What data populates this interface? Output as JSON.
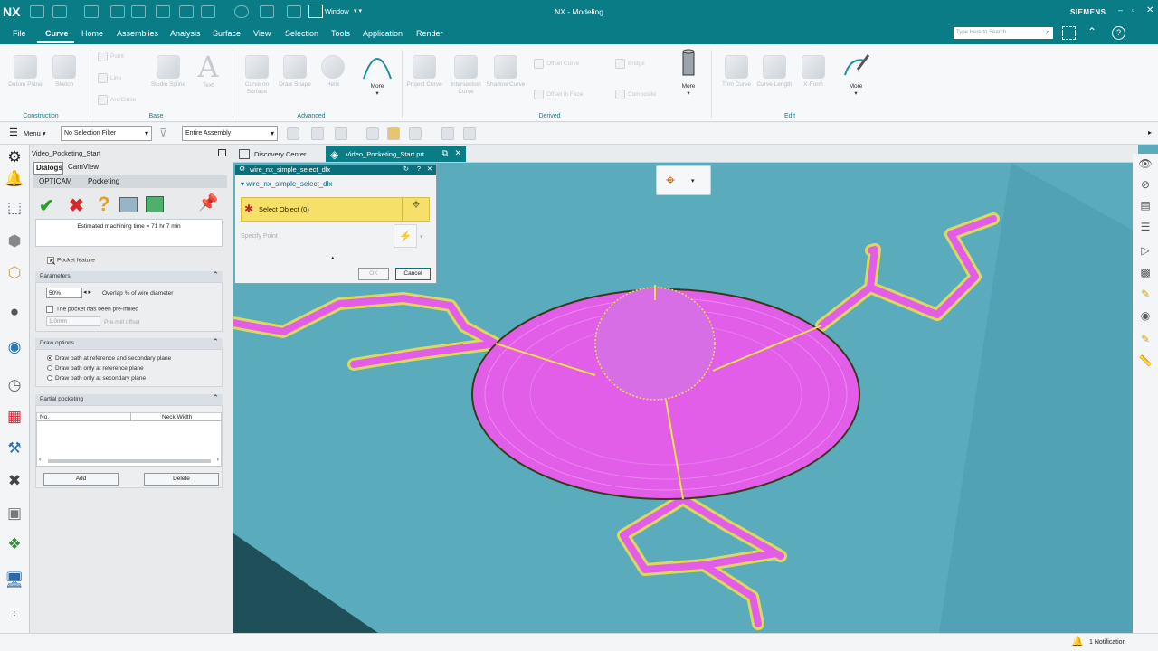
{
  "app": {
    "logo": "NX",
    "window_title": "NX - Modeling",
    "brand": "SIEMENS",
    "window_menu": "Window"
  },
  "menubar": {
    "items": [
      "File",
      "Curve",
      "Home",
      "Assemblies",
      "Analysis",
      "Surface",
      "View",
      "Selection",
      "Tools",
      "Application",
      "Render"
    ],
    "active": "Curve",
    "search_placeholder": "Type Here to Search"
  },
  "ribbon": {
    "groups": [
      "Construction",
      "Base",
      "Advanced",
      "Derived",
      "Edit"
    ],
    "buttons": {
      "datum_plane": "Datum Plane",
      "sketch": "Sketch",
      "point": "Point",
      "line": "Line",
      "arc_circle": "Arc/Circle",
      "studio_spline": "Studio Spline",
      "text": "Text",
      "curve_on_surface": "Curve on Surface",
      "draw_shape": "Draw Shape",
      "helix": "Helix",
      "more1": "More",
      "project_curve": "Project Curve",
      "intersection_curve": "Intersection Curve",
      "shadow_curve": "Shadow Curve",
      "offset_curve": "Offset Curve",
      "offset_in_face": "Offset in Face",
      "bridge": "Bridge",
      "composite": "Composite",
      "more2": "More",
      "trim_curve": "Trim Curve",
      "curve_length": "Curve Length",
      "x_form": "X-Form",
      "more3": "More"
    }
  },
  "toolbar": {
    "menu_label": "Menu",
    "selection_filter": "No Selection Filter",
    "scope": "Entire Assembly"
  },
  "panel": {
    "title": "Video_Pocketing_Start",
    "tabs": [
      "Dialogs",
      "CamView"
    ],
    "subtabs": [
      "OPTICAM",
      "Pocketing"
    ],
    "estimate": "Estimated machining time = 71 hr 7 min",
    "pocket_feature": "Pocket feature",
    "parameters": {
      "header": "Parameters",
      "overlap_value": "50%",
      "overlap_label": "Overlap % of wire diameter",
      "premilled_label": "The pocket has been pre-milled",
      "offset_value": "1.0mm",
      "offset_label": "Pre-mill offset"
    },
    "draw_options": {
      "header": "Draw options",
      "options": [
        "Draw path at reference and secondary plane",
        "Draw path only at reference plane",
        "Draw path only at secondary plane"
      ],
      "selected": 0
    },
    "partial": {
      "header": "Partial pocketing",
      "col_no": "No.",
      "col_neck": "Neck Width",
      "add": "Add",
      "delete": "Delete"
    }
  },
  "tabs": {
    "discovery": "Discovery Center",
    "file": "Video_Pocketing_Start.prt"
  },
  "dialog": {
    "title": "wire_nx_simple_select_dlx",
    "section": "wire_nx_simple_select_dlx",
    "select_object": "Select Object (0)",
    "specify_point": "Specify Point",
    "ok": "OK",
    "cancel": "Cancel"
  },
  "status": {
    "notification": "1 Notification"
  },
  "colors": {
    "teal": "#0a7c86",
    "viewport": "#5aabbc",
    "pocket": "#e25ee8",
    "path": "#f2e04a"
  }
}
